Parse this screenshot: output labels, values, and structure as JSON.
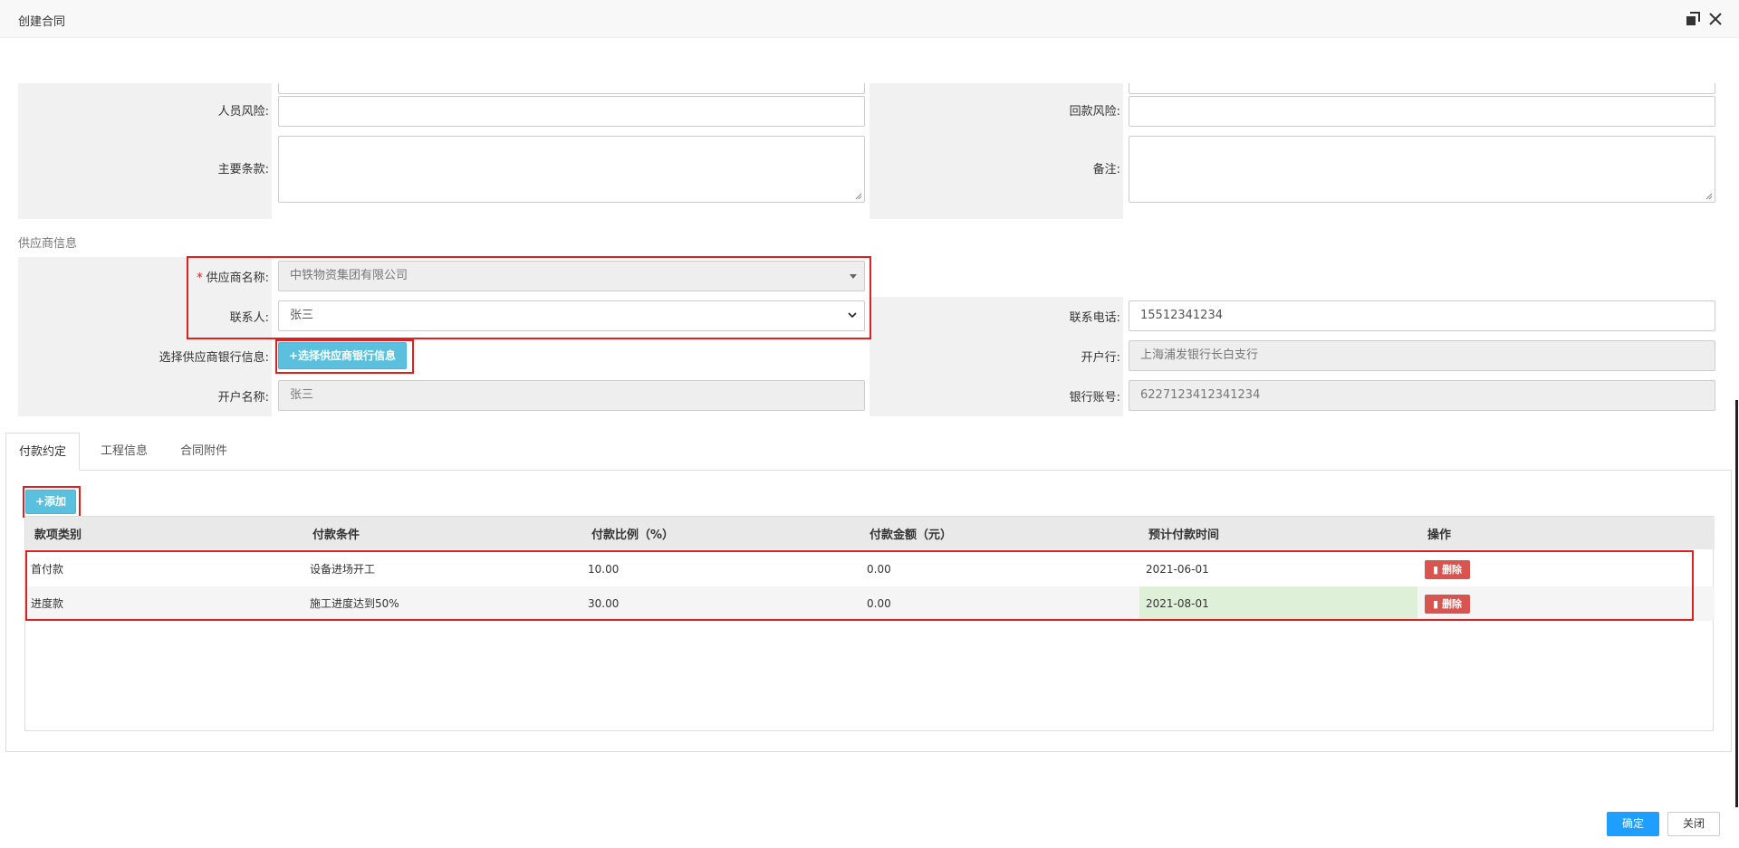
{
  "window": {
    "title": "创建合同"
  },
  "form": {
    "personnel_risk": {
      "label": "人员风险:",
      "value": ""
    },
    "receivable_risk": {
      "label": "回款风险:",
      "value": ""
    },
    "main_terms": {
      "label": "主要条款:",
      "value": ""
    },
    "remarks": {
      "label": "备注:",
      "value": ""
    }
  },
  "supplier": {
    "section_title": "供应商信息",
    "name": {
      "required_mark": "*",
      "label": "供应商名称:",
      "value": "中铁物资集团有限公司"
    },
    "contact": {
      "label": "联系人:",
      "value": "张三",
      "options": [
        "张三"
      ]
    },
    "phone": {
      "label": "联系电话:",
      "value": "15512341234"
    },
    "bank_select": {
      "label": "选择供应商银行信息:",
      "button": "选择供应商银行信息"
    },
    "bank": {
      "label": "开户行:",
      "value": "上海浦发银行长白支行"
    },
    "account_name": {
      "label": "开户名称:",
      "value": "张三"
    },
    "account_no": {
      "label": "银行账号:",
      "value": "6227123412341234"
    }
  },
  "tabs": [
    {
      "label": "付款约定",
      "active": true
    },
    {
      "label": "工程信息",
      "active": false
    },
    {
      "label": "合同附件",
      "active": false
    }
  ],
  "payment": {
    "add_button": "添加",
    "columns": [
      "款项类别",
      "付款条件",
      "付款比例（%）",
      "付款金额（元）",
      "预计付款时间",
      "操作"
    ],
    "rows": [
      {
        "type": "首付款",
        "condition": "设备进场开工",
        "ratio": "10.00",
        "amount": "0.00",
        "date": "2021-06-01",
        "action": "删除"
      },
      {
        "type": "进度款",
        "condition": "施工进度达到50%",
        "ratio": "30.00",
        "amount": "0.00",
        "date": "2021-08-01",
        "action": "删除"
      }
    ]
  },
  "footer": {
    "confirm": "确定",
    "close": "关闭"
  },
  "colors": {
    "primary": "#1e9fff",
    "info": "#5bc0de",
    "danger": "#d9534f",
    "highlight": "#e02020"
  }
}
